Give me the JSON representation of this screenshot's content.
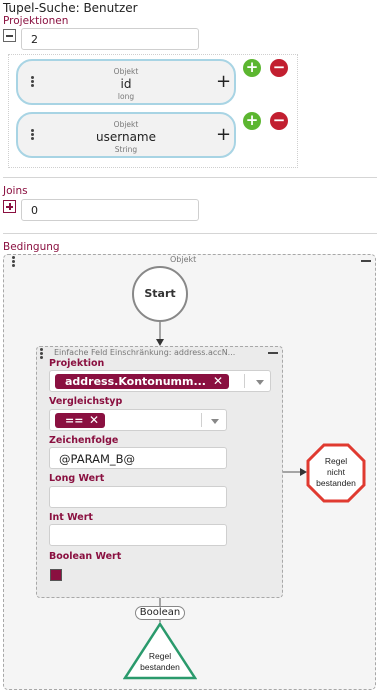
{
  "title": "Tupel-Suche: Benutzer",
  "projektionen": {
    "label": "Projektionen",
    "count": "2",
    "items": [
      {
        "kind": "Objekt",
        "name": "id",
        "type": "long"
      },
      {
        "kind": "Objekt",
        "name": "username",
        "type": "String"
      }
    ]
  },
  "joins": {
    "label": "Joins",
    "count": "0"
  },
  "bedingung": {
    "label": "Bedingung",
    "group_title": "Objekt",
    "start_label": "Start",
    "constraint": {
      "title": "Einfache Feld Einschränkung: address.accN...",
      "projektion_label": "Projektion",
      "projektion_value": "address.Kontonumm...",
      "vergleichstyp_label": "Vergleichstyp",
      "vergleichstyp_value": "==",
      "zeichenfolge_label": "Zeichenfolge",
      "zeichenfolge_value": "@PARAM_B@",
      "long_label": "Long Wert",
      "long_value": "",
      "int_label": "Int Wert",
      "int_value": "",
      "boolean_label": "Boolean Wert"
    },
    "fail_label": "Regel nicht bestanden",
    "fail_lines": [
      "Regel",
      "nicht",
      "bestanden"
    ],
    "edge_label": "Boolean",
    "pass_label": "Regel bestanden",
    "pass_lines": [
      "Regel",
      "bestanden"
    ]
  },
  "colors": {
    "accent": "#8a1040",
    "pill_border": "#a8d4e4",
    "add": "#5cb630",
    "remove": "#c21f30",
    "pass": "#2a9a6c",
    "fail": "#e03a30"
  },
  "icons": {
    "collapse": "minus-square-icon",
    "expand": "plus-square-icon",
    "add": "plus-circle-icon",
    "remove": "minus-circle-icon",
    "drag": "drag-handle-icon",
    "clear": "x-icon",
    "dropdown": "chevron-down-icon"
  }
}
